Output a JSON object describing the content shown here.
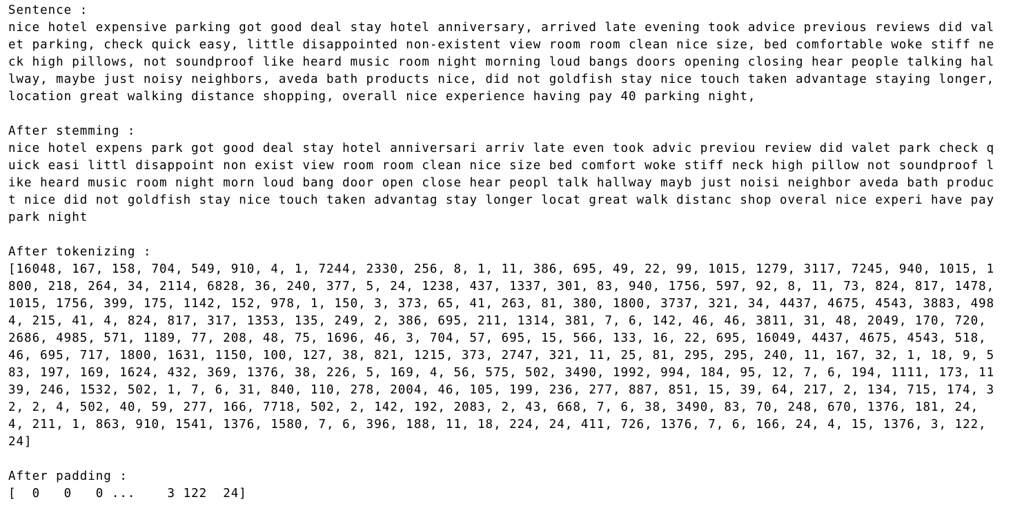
{
  "sentence": {
    "label": "Sentence :",
    "text": "nice hotel expensive parking got good deal stay hotel anniversary, arrived late evening took advice previous reviews did valet parking, check quick easy, little disappointed non-existent view room room clean nice size, bed comfortable woke stiff neck high pillows, not soundproof like heard music room night morning loud bangs doors opening closing hear people talking hallway, maybe just noisy neighbors, aveda bath products nice, did not goldfish stay nice touch taken advantage staying longer, location great walking distance shopping, overall nice experience having pay 40 parking night,"
  },
  "stemming": {
    "label": "After stemming :",
    "text": "nice hotel expens park got good deal stay hotel anniversari arriv late even took advic previou review did valet park check quick easi littl disappoint non exist view room room clean nice size bed comfort woke stiff neck high pillow not soundproof like heard music room night morn loud bang door open close hear peopl talk hallway mayb just noisi neighbor aveda bath product nice did not goldfish stay nice touch taken advantag stay longer locat great walk distanc shop overal nice experi have pay park night"
  },
  "tokenizing": {
    "label": "After tokenizing :",
    "text": "[16048, 167, 158, 704, 549, 910, 4, 1, 7244, 2330, 256, 8, 1, 11, 386, 695, 49, 22, 99, 1015, 1279, 3117, 7245, 940, 1015, 1800, 218, 264, 34, 2114, 6828, 36, 240, 377, 5, 24, 1238, 437, 1337, 301, 83, 940, 1756, 597, 92, 8, 11, 73, 824, 817, 1478, 1015, 1756, 399, 175, 1142, 152, 978, 1, 150, 3, 373, 65, 41, 263, 81, 380, 1800, 3737, 321, 34, 4437, 4675, 4543, 3883, 4984, 215, 41, 4, 824, 817, 317, 1353, 135, 249, 2, 386, 695, 211, 1314, 381, 7, 6, 142, 46, 46, 3811, 31, 48, 2049, 170, 720, 2686, 4985, 571, 1189, 77, 208, 48, 75, 1696, 46, 3, 704, 57, 695, 15, 566, 133, 16, 22, 695, 16049, 4437, 4675, 4543, 518, 46, 695, 717, 1800, 1631, 1150, 100, 127, 38, 821, 1215, 373, 2747, 321, 11, 25, 81, 295, 295, 240, 11, 167, 32, 1, 18, 9, 583, 197, 169, 1624, 432, 369, 1376, 38, 226, 5, 169, 4, 56, 575, 502, 3490, 1992, 994, 184, 95, 12, 7, 6, 194, 1111, 173, 1139, 246, 1532, 502, 1, 7, 6, 31, 840, 110, 278, 2004, 46, 105, 199, 236, 277, 887, 851, 15, 39, 64, 217, 2, 134, 715, 174, 32, 2, 4, 502, 40, 59, 277, 166, 7718, 502, 2, 142, 192, 2083, 2, 43, 668, 7, 6, 38, 3490, 83, 70, 248, 670, 1376, 181, 24, 4, 211, 1, 863, 910, 1541, 1376, 1580, 7, 6, 396, 188, 11, 18, 224, 24, 411, 726, 1376, 7, 6, 166, 24, 4, 15, 1376, 3, 122, 24]"
  },
  "padding": {
    "label": "After padding :",
    "text": "[  0   0   0 ...    3 122  24]"
  }
}
